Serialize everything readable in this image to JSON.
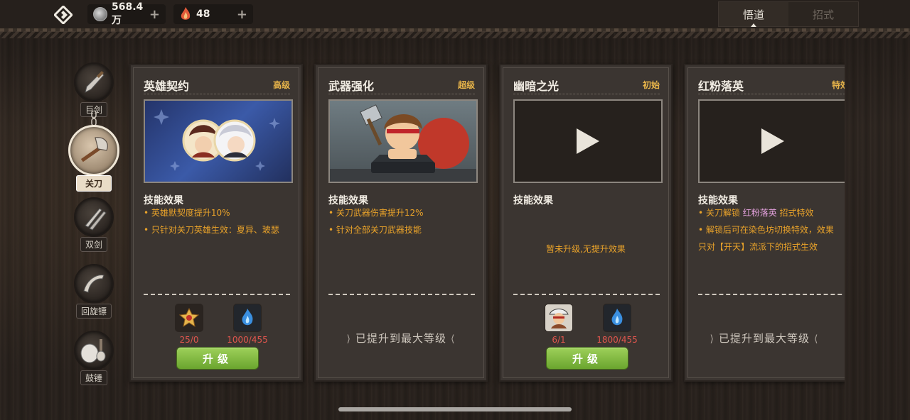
{
  "top_bar": {
    "silver": "568.4万",
    "crystal": "48",
    "plus": "+",
    "tabs": [
      {
        "label": "悟道",
        "active": true
      },
      {
        "label": "招式",
        "active": false
      }
    ]
  },
  "sidebar": {
    "items": [
      {
        "label": "巨剑",
        "active": false
      },
      {
        "label": "关刀",
        "active": true
      },
      {
        "label": "双剑",
        "active": false
      },
      {
        "label": "回旋镖",
        "active": false
      },
      {
        "label": "鼓锤",
        "active": false
      }
    ]
  },
  "cards": [
    {
      "title": "英雄契约",
      "tier": "高级",
      "section": "技能效果",
      "effects": [
        "• 英雄默契度提升10%",
        "• 只针对关刀英雄生效：夏异、玻瑟"
      ],
      "costs": [
        "25/0",
        "1000/455"
      ],
      "button": "升级"
    },
    {
      "title": "武器强化",
      "tier": "超级",
      "section": "技能效果",
      "effects": [
        "• 关刀武器伤害提升12%",
        "• 针对全部关刀武器技能"
      ],
      "maxed": "已提升到最大等级"
    },
    {
      "title": "幽暗之光",
      "tier": "初始",
      "section": "技能效果",
      "empty_effect": "暂未升级,无提升效果",
      "costs": [
        "6/1",
        "1800/455"
      ],
      "button": "升级"
    },
    {
      "title": "红粉落英",
      "tier": "特效",
      "section": "技能效果",
      "effect1_prefix": "• 关刀解锁 ",
      "effect1_highlight": "红粉落英",
      "effect1_suffix": " 招式特效",
      "effect2": "• 解锁后可在染色坊切换特效，效果",
      "effect3": "只对【开天】流派下的招式生效",
      "maxed": "已提升到最大等级"
    }
  ],
  "colors": {
    "tier": "#e8b54a",
    "effect": "#eaa32a",
    "cost_red": "#e2564e",
    "button_green": "#7bb63a",
    "highlight_pink": "#e6a3e0"
  }
}
